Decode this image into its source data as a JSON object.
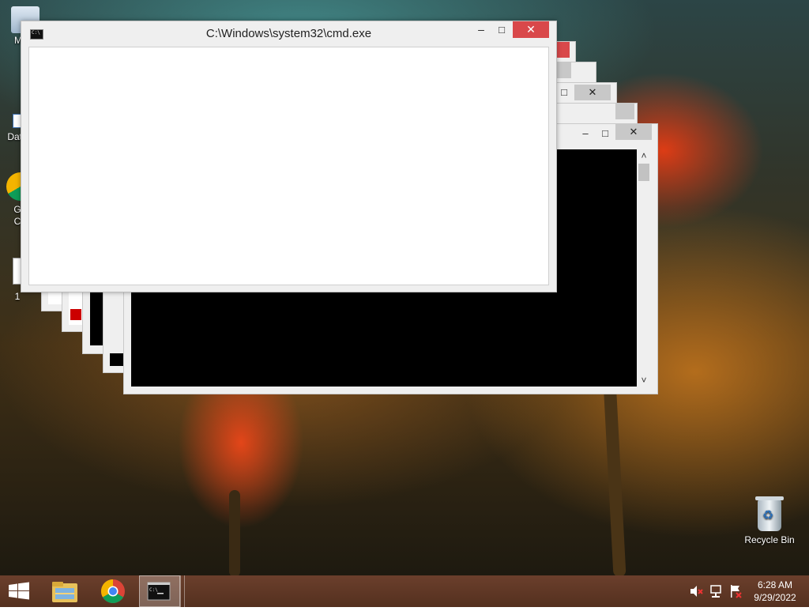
{
  "window": {
    "title": "C:\\Windows\\system32\\cmd.exe",
    "minimize_glyph": "–",
    "maximize_glyph": "□",
    "close_glyph": "✕"
  },
  "back_windows": {
    "close_glyph": "✕",
    "minimize_glyph": "–",
    "maximize_glyph": "□",
    "scroll_up_glyph": "˄",
    "scroll_down_glyph": "˅"
  },
  "desktop_icons": {
    "my_computer_label": "My C",
    "data_label": "Data",
    "google_chrome_label_1": "G",
    "google_chrome_label_2": "C",
    "partial_label": "1",
    "recycle_bin_label": "Recycle Bin"
  },
  "taskbar": {
    "start_icon": "windows-logo-icon",
    "pinned": [
      "file-explorer-icon",
      "chrome-icon",
      "cmd-icon"
    ],
    "tray": {
      "icons": [
        "volume-muted-icon",
        "network-icon",
        "action-center-flag-icon"
      ],
      "time": "6:28 AM",
      "date": "9/29/2022"
    }
  },
  "colors": {
    "close_button": "#d9484a",
    "taskbar": "#5e3726",
    "console_background": "#000000"
  }
}
